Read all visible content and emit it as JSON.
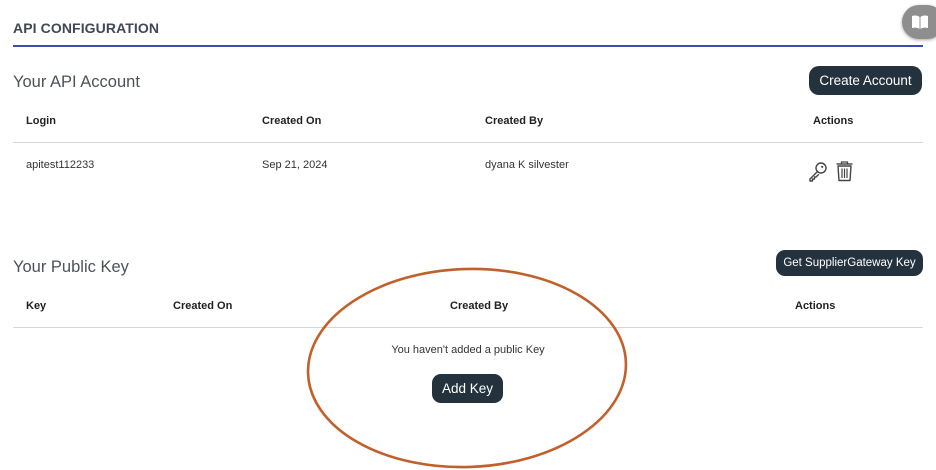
{
  "header": {
    "title": "API CONFIGURATION"
  },
  "api_account": {
    "title": "Your API Account",
    "create_button": "Create Account",
    "columns": [
      "Login",
      "Created On",
      "Created By",
      "Actions"
    ],
    "rows": [
      {
        "login": "apitest112233",
        "created_on": "Sep 21, 2024",
        "created_by": "dyana K silvester"
      }
    ],
    "row_icons": [
      "key-icon",
      "trash-icon"
    ]
  },
  "public_key": {
    "title": "Your Public Key",
    "get_key_button": "Get SupplierGateway Key",
    "columns": [
      "Key",
      "Created On",
      "Created By",
      "Actions"
    ],
    "empty_message": "You haven't added a public Key",
    "add_key_button": "Add Key"
  },
  "colors": {
    "accent_rule": "#3b4ab8",
    "button_dark": "#24323e",
    "annotation": "#c0602a"
  },
  "floating": {
    "icon": "book-icon"
  }
}
